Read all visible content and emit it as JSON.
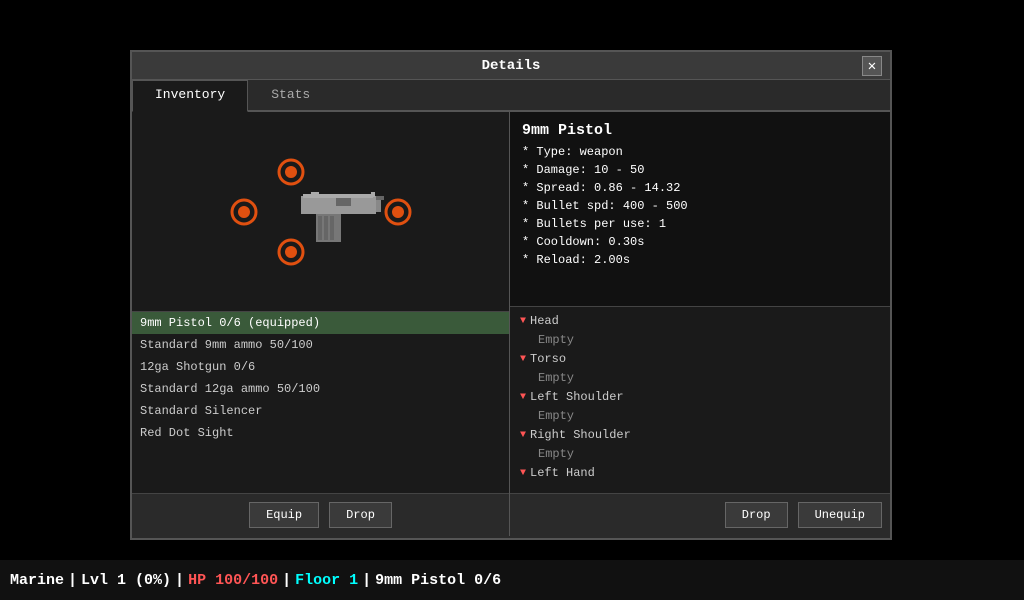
{
  "window": {
    "title": "Details",
    "close_label": "✕"
  },
  "tabs": [
    {
      "id": "inventory",
      "label": "Inventory",
      "active": true
    },
    {
      "id": "stats",
      "label": "Stats",
      "active": false
    }
  ],
  "item_stats": {
    "name": "9mm Pistol",
    "lines": [
      "* Type: weapon",
      "* Damage: 10 - 50",
      "* Spread: 0.86 - 14.32",
      "* Bullet spd: 400 - 500",
      "* Bullets per use: 1",
      "* Cooldown: 0.30s",
      "* Reload: 2.00s"
    ]
  },
  "inventory_items": [
    {
      "label": "9mm Pistol 0/6 (equipped)",
      "selected": true
    },
    {
      "label": "Standard 9mm ammo 50/100",
      "selected": false
    },
    {
      "label": "12ga Shotgun 0/6",
      "selected": false
    },
    {
      "label": "Standard 12ga ammo 50/100",
      "selected": false
    },
    {
      "label": "Standard Silencer",
      "selected": false
    },
    {
      "label": "Red Dot Sight",
      "selected": false
    }
  ],
  "left_buttons": [
    {
      "id": "equip",
      "label": "Equip"
    },
    {
      "id": "drop-left",
      "label": "Drop"
    }
  ],
  "equipment_slots": [
    {
      "header": "Head",
      "value": "Empty"
    },
    {
      "header": "Torso",
      "value": "Empty"
    },
    {
      "header": "Left Shoulder",
      "value": "Empty"
    },
    {
      "header": "Right Shoulder",
      "value": "Empty"
    },
    {
      "header": "Left Hand",
      "value": ""
    }
  ],
  "right_buttons": [
    {
      "id": "drop-right",
      "label": "Drop"
    },
    {
      "id": "unequip",
      "label": "Unequip"
    }
  ],
  "status_bar": {
    "name": "Marine",
    "sep1": " | ",
    "level": "Lvl 1 (0%)",
    "sep2": " | ",
    "hp": "HP 100/100",
    "sep3": " | ",
    "floor": "Floor 1",
    "sep4": " | ",
    "weapon": "9mm Pistol 0/6"
  }
}
